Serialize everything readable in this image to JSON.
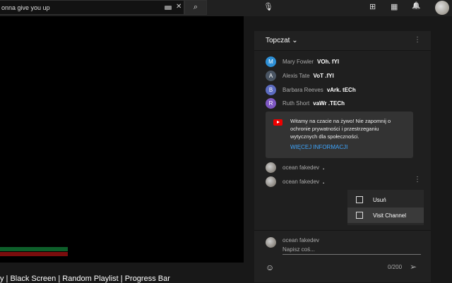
{
  "search": {
    "value": "onna give you up",
    "clear": "✕",
    "search_icon": "search-icon",
    "mic_icon": "mic-icon"
  },
  "topbar": {
    "create": "⊞",
    "apps": "▦",
    "bell": "🔔"
  },
  "video": {
    "title": "y | Black Screen | Random Playlist | Progress Bar",
    "progress_colors": [
      "#0d5f2a",
      "#7a0d0d"
    ]
  },
  "chat": {
    "mode": "Topczat",
    "messages": [
      {
        "initial": "M",
        "author": "Mary Fowler",
        "text": "VOh. fYI",
        "color": "#2d8fd5"
      },
      {
        "initial": "A",
        "author": "Alexis Tate",
        "text": "VoT .fYI",
        "color": "#4a5563"
      },
      {
        "initial": "B",
        "author": "Barbara Reeves",
        "text": "vArk. tECh",
        "color": "#5c6bc0"
      },
      {
        "initial": "R",
        "author": "Ruth Short",
        "text": "vaWr .TECh",
        "color": "#7e57c2"
      }
    ],
    "notice": {
      "text": "Witamy na czacie na żywo! Nie zapomnij o ochronie prywatności i przestrzeganiu wytycznych dla społeczności.",
      "link": "WIĘCEJ INFORMACJI"
    },
    "own_messages": [
      {
        "author": "ocean fakedev",
        "text": "."
      },
      {
        "author": "ocean fakedev",
        "text": "."
      }
    ],
    "menu": {
      "items": [
        "Usuń",
        "Visit Channel"
      ]
    },
    "input": {
      "author": "ocean fakedev",
      "placeholder": "Napisz coś...",
      "count": "0/200"
    }
  }
}
